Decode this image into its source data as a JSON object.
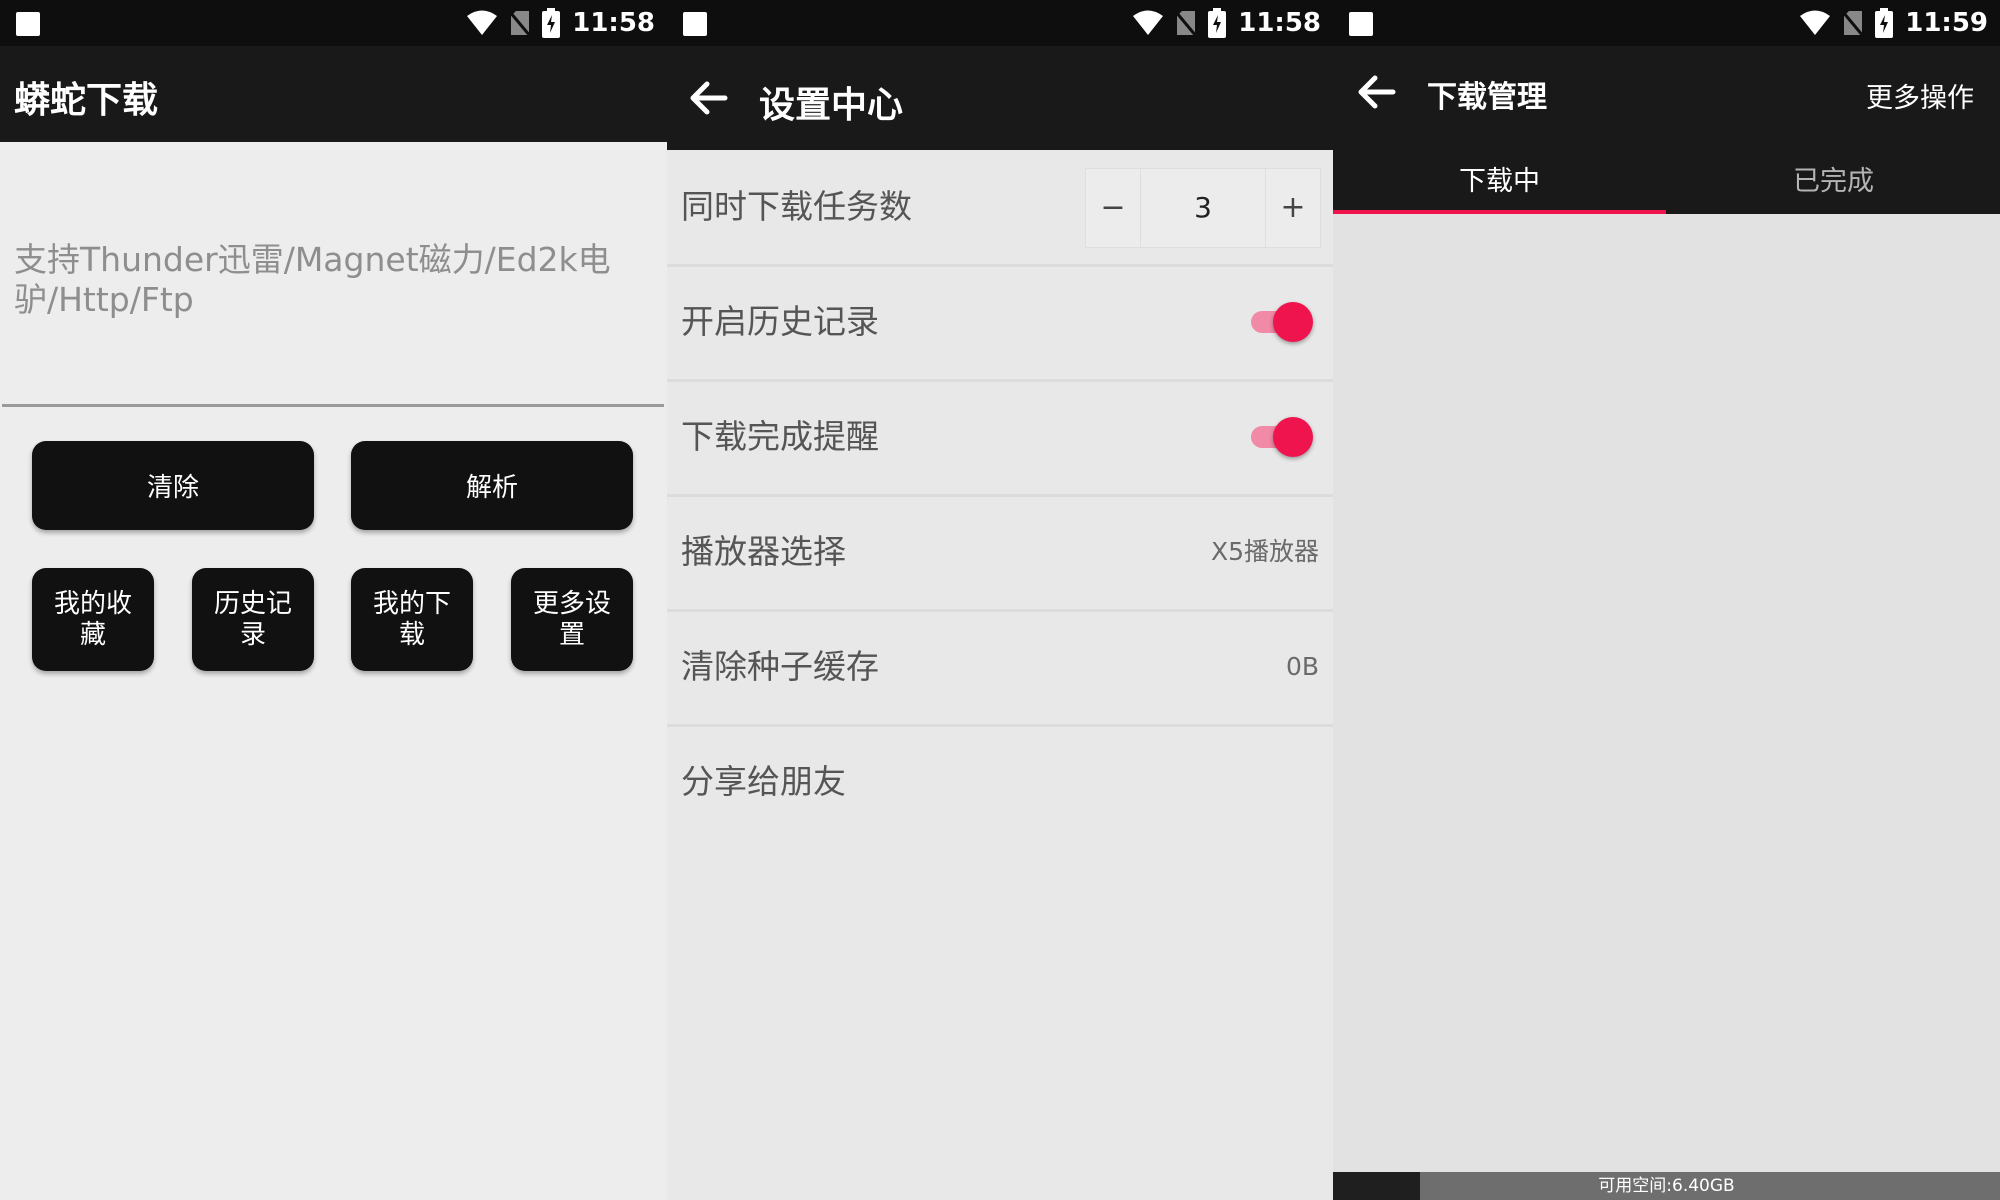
{
  "panels": [
    {
      "status": {
        "time": "11:58"
      },
      "appbar": {
        "title": "蟒蛇下载"
      },
      "input": {
        "placeholder": "支持Thunder迅雷/Magnet磁力/Ed2k电驴/Http/Ftp"
      },
      "buttons": {
        "clear": "清除",
        "parse": "解析"
      },
      "nav": [
        {
          "label": "我的收藏"
        },
        {
          "label": "历史记录"
        },
        {
          "label": "我的下载"
        },
        {
          "label": "更多设置"
        }
      ]
    },
    {
      "status": {
        "time": "11:58"
      },
      "appbar": {
        "title": "设置中心"
      },
      "settings": [
        {
          "label": "同时下载任务数",
          "control": "stepper",
          "value": "3",
          "minus": "−",
          "plus": "+"
        },
        {
          "label": "开启历史记录",
          "control": "switch",
          "checked": true
        },
        {
          "label": "下载完成提醒",
          "control": "switch",
          "checked": true
        },
        {
          "label": "播放器选择",
          "control": "value",
          "value": "X5播放器"
        },
        {
          "label": "清除种子缓存",
          "control": "value",
          "value": "0B"
        },
        {
          "label": "分享给朋友",
          "control": "none"
        }
      ]
    },
    {
      "status": {
        "time": "11:59"
      },
      "appbar": {
        "title": "下载管理",
        "action": "更多操作"
      },
      "tabs": [
        {
          "label": "下载中",
          "active": true
        },
        {
          "label": "已完成",
          "active": false
        }
      ],
      "storage": {
        "label": "可用空间:6.40GB",
        "used_fraction": 0.13
      }
    }
  ],
  "colors": {
    "accent": "#f0144e",
    "appbar": "#191919",
    "statusbar": "#0e0e0e"
  }
}
